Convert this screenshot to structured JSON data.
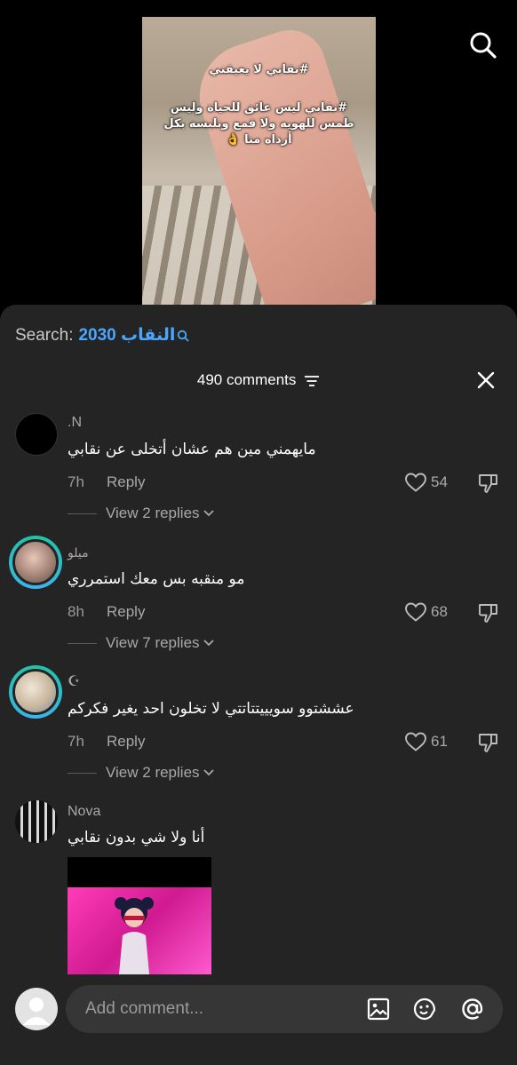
{
  "video": {
    "caption_line1": "#نقابي لا يعيقني",
    "caption_line2": "#نقابي ليس عائق للحياة وليس طمس للهويه ولا قمع ونلبسه بكل أرداه منا 👌"
  },
  "search": {
    "label": "Search:",
    "keyword": "النقاب 2030"
  },
  "header": {
    "count_label": "490 comments"
  },
  "comments": [
    {
      "user": "N.",
      "text": "مايهمني مين هم عشان أتخلى عن نقابي",
      "time": "7h",
      "reply_label": "Reply",
      "likes": "54",
      "view_replies": "View 2 replies"
    },
    {
      "user": "ميلو",
      "text": "مو منقبه بس معك استمرري",
      "time": "8h",
      "reply_label": "Reply",
      "likes": "68",
      "view_replies": "View 7 replies"
    },
    {
      "user": "☪︎",
      "text": "عششتوو سويييتتاتتي لا تخلون احد يغير فكركم",
      "time": "7h",
      "reply_label": "Reply",
      "likes": "61",
      "view_replies": "View 2 replies"
    },
    {
      "user": "Nova",
      "text": "أنا ولا شي بدون نقابي"
    }
  ],
  "composer": {
    "placeholder": "Add comment..."
  },
  "colors": {
    "accent": "#4aa6ff",
    "sheet_bg": "#242424",
    "ring": "#22c3a0"
  },
  "icons": [
    "search-icon",
    "filter-icon",
    "close-icon",
    "heart-icon",
    "dislike-icon",
    "chevron-down-icon",
    "image-icon",
    "emoji-icon",
    "mention-icon"
  ]
}
